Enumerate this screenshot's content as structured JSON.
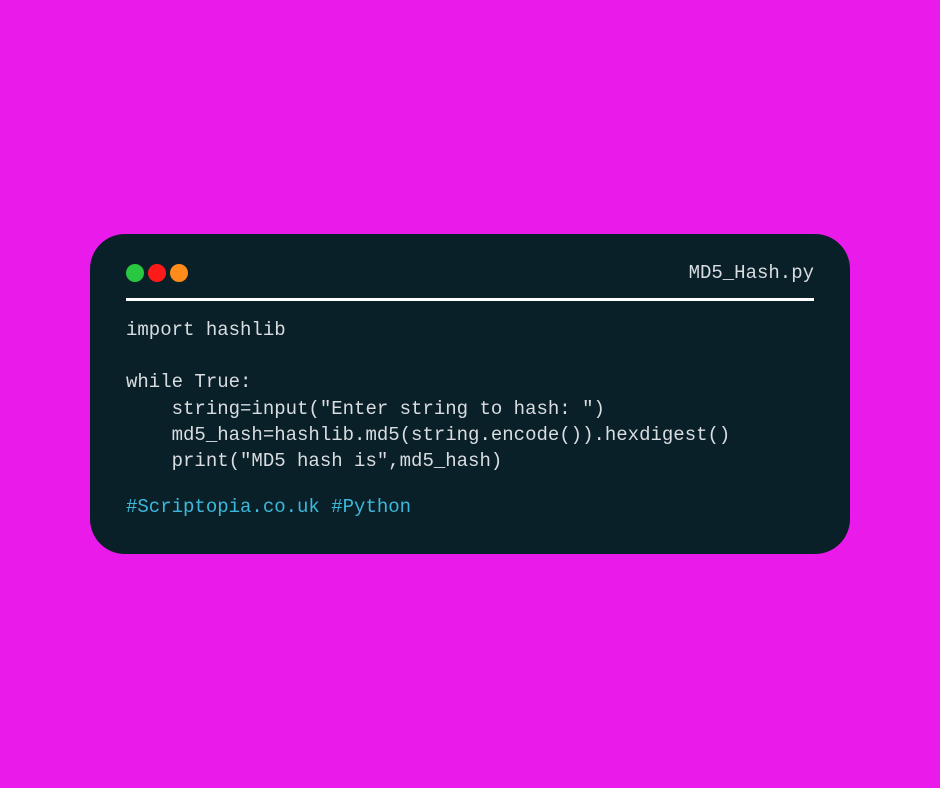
{
  "terminal": {
    "filename": "MD5_Hash.py",
    "code_lines": [
      "import hashlib",
      "",
      "while True:",
      "    string=input(\"Enter string to hash: \")",
      "    md5_hash=hashlib.md5(string.encode()).hexdigest()",
      "    print(\"MD5 hash is\",md5_hash)"
    ],
    "hashtags": "#Scriptopia.co.uk #Python"
  },
  "colors": {
    "background": "#ea1aea",
    "terminal_bg": "#0a2028",
    "text": "#d9dce0",
    "hashtag": "#3bb8dc",
    "dot_green": "#28c840",
    "dot_red": "#ff1a1a",
    "dot_orange": "#ff8c1a"
  }
}
